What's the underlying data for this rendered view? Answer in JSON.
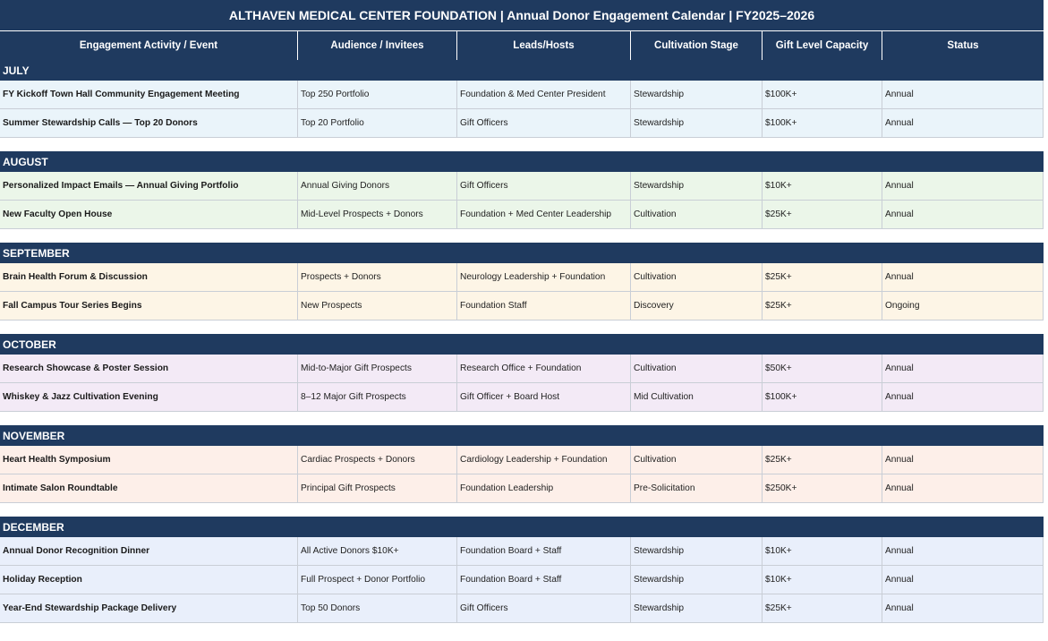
{
  "title": "ALTHAVEN MEDICAL CENTER FOUNDATION  |  Annual Donor Engagement Calendar  |  FY2025–2026",
  "headers": [
    "Engagement Activity / Event",
    "Audience / Invitees",
    "Leads/Hosts",
    "Cultivation Stage",
    "Gift Level Capacity",
    "Status"
  ],
  "sections": [
    {
      "month": "JULY",
      "tint": "t-jul",
      "rows": [
        [
          "FY Kickoff Town Hall Community Engagement Meeting",
          "Top 250 Portfolio",
          "Foundation & Med Center President",
          "Stewardship",
          "$100K+",
          "Annual"
        ],
        [
          "Summer Stewardship Calls — Top 20 Donors",
          "Top 20 Portfolio",
          "Gift Officers",
          "Stewardship",
          "$100K+",
          "Annual"
        ]
      ]
    },
    {
      "month": "AUGUST",
      "tint": "t-aug",
      "rows": [
        [
          "Personalized Impact Emails — Annual Giving Portfolio",
          "Annual Giving Donors",
          "Gift Officers",
          "Stewardship",
          "$10K+",
          "Annual"
        ],
        [
          "New Faculty Open House",
          "Mid-Level Prospects + Donors",
          "Foundation + Med Center Leadership",
          "Cultivation",
          "$25K+",
          "Annual"
        ]
      ]
    },
    {
      "month": "SEPTEMBER",
      "tint": "t-sep",
      "rows": [
        [
          "Brain Health Forum & Discussion",
          "Prospects + Donors",
          "Neurology Leadership + Foundation",
          "Cultivation",
          "$25K+",
          "Annual"
        ],
        [
          "Fall Campus Tour Series Begins",
          "New Prospects",
          "Foundation Staff",
          "Discovery",
          "$25K+",
          "Ongoing"
        ]
      ]
    },
    {
      "month": "OCTOBER",
      "tint": "t-oct",
      "rows": [
        [
          "Research Showcase & Poster Session",
          "Mid-to-Major Gift Prospects",
          "Research Office + Foundation",
          "Cultivation",
          "$50K+",
          "Annual"
        ],
        [
          "Whiskey & Jazz Cultivation Evening",
          "8–12 Major Gift Prospects",
          "Gift Officer + Board Host",
          "Mid Cultivation",
          "$100K+",
          "Annual"
        ]
      ]
    },
    {
      "month": "NOVEMBER",
      "tint": "t-nov",
      "rows": [
        [
          "Heart Health Symposium",
          "Cardiac Prospects + Donors",
          "Cardiology Leadership + Foundation",
          "Cultivation",
          "$25K+",
          "Annual"
        ],
        [
          "Intimate Salon Roundtable",
          "Principal Gift Prospects",
          "Foundation Leadership",
          "Pre-Solicitation",
          "$250K+",
          "Annual"
        ]
      ]
    },
    {
      "month": "DECEMBER",
      "tint": "t-dec",
      "rows": [
        [
          "Annual Donor Recognition Dinner",
          "All Active Donors $10K+",
          "Foundation Board + Staff",
          "Stewardship",
          "$10K+",
          "Annual"
        ],
        [
          "Holiday Reception",
          "Full Prospect + Donor Portfolio",
          "Foundation Board + Staff",
          "Stewardship",
          "$10K+",
          "Annual"
        ],
        [
          "Year-End Stewardship Package Delivery",
          "Top 50 Donors",
          "Gift Officers",
          "Stewardship",
          "$25K+",
          "Annual"
        ]
      ]
    }
  ]
}
